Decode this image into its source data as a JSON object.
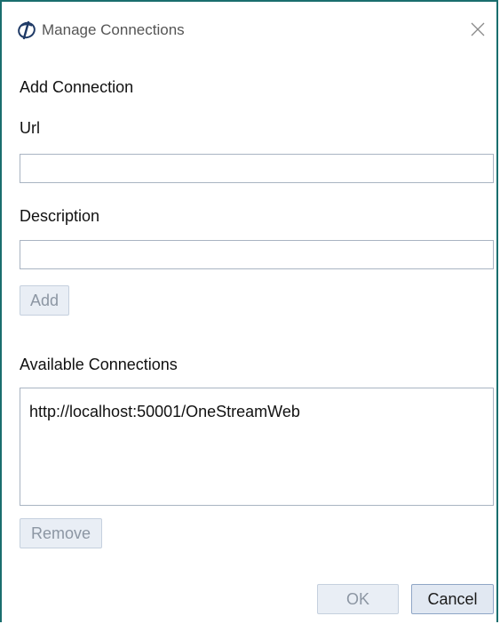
{
  "window": {
    "title": "Manage Connections"
  },
  "add_section": {
    "heading": "Add Connection",
    "url_label": "Url",
    "url_value": "",
    "description_label": "Description",
    "description_value": "",
    "add_button": "Add"
  },
  "available": {
    "heading": "Available Connections",
    "items": [
      "http://localhost:50001/OneStreamWeb"
    ],
    "remove_button": "Remove"
  },
  "footer": {
    "ok_button": "OK",
    "cancel_button": "Cancel"
  },
  "icons": {
    "app_logo": "onestream-logo-icon",
    "close": "close-icon"
  },
  "colors": {
    "window_border": "#1a6e6e",
    "disabled_button_bg": "#e9eef5",
    "enabled_button_border": "#8fa6c6"
  }
}
